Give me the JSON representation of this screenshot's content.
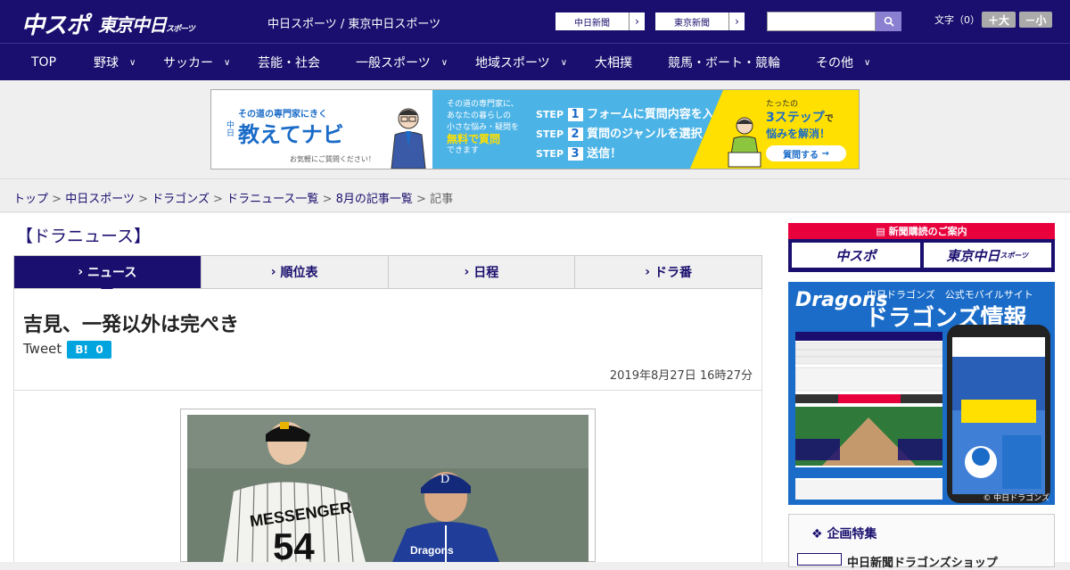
{
  "header": {
    "logo_main": "中スポ",
    "logo_sub": "東京中日",
    "logo_sub_small": "スポーツ",
    "site_title": "中日スポーツ / 東京中日スポーツ",
    "btn_chunichi": "中日新聞",
    "btn_tokyo": "東京新聞",
    "font_size_label": "文字（0）",
    "font_up": "＋大",
    "font_down": "－小"
  },
  "nav": {
    "items": [
      {
        "label": "TOP"
      },
      {
        "label": "野球"
      },
      {
        "label": "サッカー"
      },
      {
        "label": "芸能・社会"
      },
      {
        "label": "一般スポーツ"
      },
      {
        "label": "地域スポーツ"
      },
      {
        "label": "大相撲"
      },
      {
        "label": "競馬・ボート・競輪"
      },
      {
        "label": "その他"
      }
    ]
  },
  "ad": {
    "tagline": "その道の専門家にきく",
    "brand_prefix": "中日",
    "brand": "教えてナビ",
    "note": "お気軽にご質問ください！",
    "desc1": "その道の専門家に、",
    "desc2": "あなたの暮らしの",
    "desc3": "小さな悩み・疑問を",
    "desc_highlight": "無料で質問",
    "desc4": "できます",
    "step1": "フォームに質問内容を入力",
    "step2": "質問のジャンルを選択",
    "step3": "送信！",
    "step_label": "STEP",
    "cta_top": "たったの",
    "cta_big": "3ステップ",
    "cta_de": "で",
    "cta_bottom": "悩みを解消！",
    "cta_button": "質問する"
  },
  "breadcrumb": {
    "items": [
      "トップ",
      "中日スポーツ",
      "ドラゴンズ",
      "ドラニュース一覧",
      "8月の記事一覧"
    ],
    "current": "記事",
    "sep": ">"
  },
  "section": {
    "title": "【ドラニュース】"
  },
  "tabs": [
    {
      "label": "ニュース"
    },
    {
      "label": "順位表"
    },
    {
      "label": "日程"
    },
    {
      "label": "ドラ番"
    }
  ],
  "article": {
    "headline": "吉見、一発以外は完ぺき",
    "tweet": "Tweet",
    "hatena": "B!",
    "hatena_count": "0",
    "date": "2019年8月27日 16時27分",
    "photo_jersey_name": "MESSENGER",
    "photo_jersey_number": "54"
  },
  "sidebar": {
    "subscribe_header": "新聞購読のご案内",
    "subscribe_logo1": "中スポ",
    "subscribe_logo2": "東京中日",
    "subscribe_logo2_small": "スポーツ",
    "dragons_logo": "Dragons",
    "dragons_sub": "中日ドラゴンズ　公式モバイルサイト",
    "dragons_big": "ドラゴンズ情報",
    "dragons_footer": "© 中日ドラゴンズ",
    "feature_title": "企画特集",
    "feature_item": "中日新聞ドラゴンズショップ"
  }
}
